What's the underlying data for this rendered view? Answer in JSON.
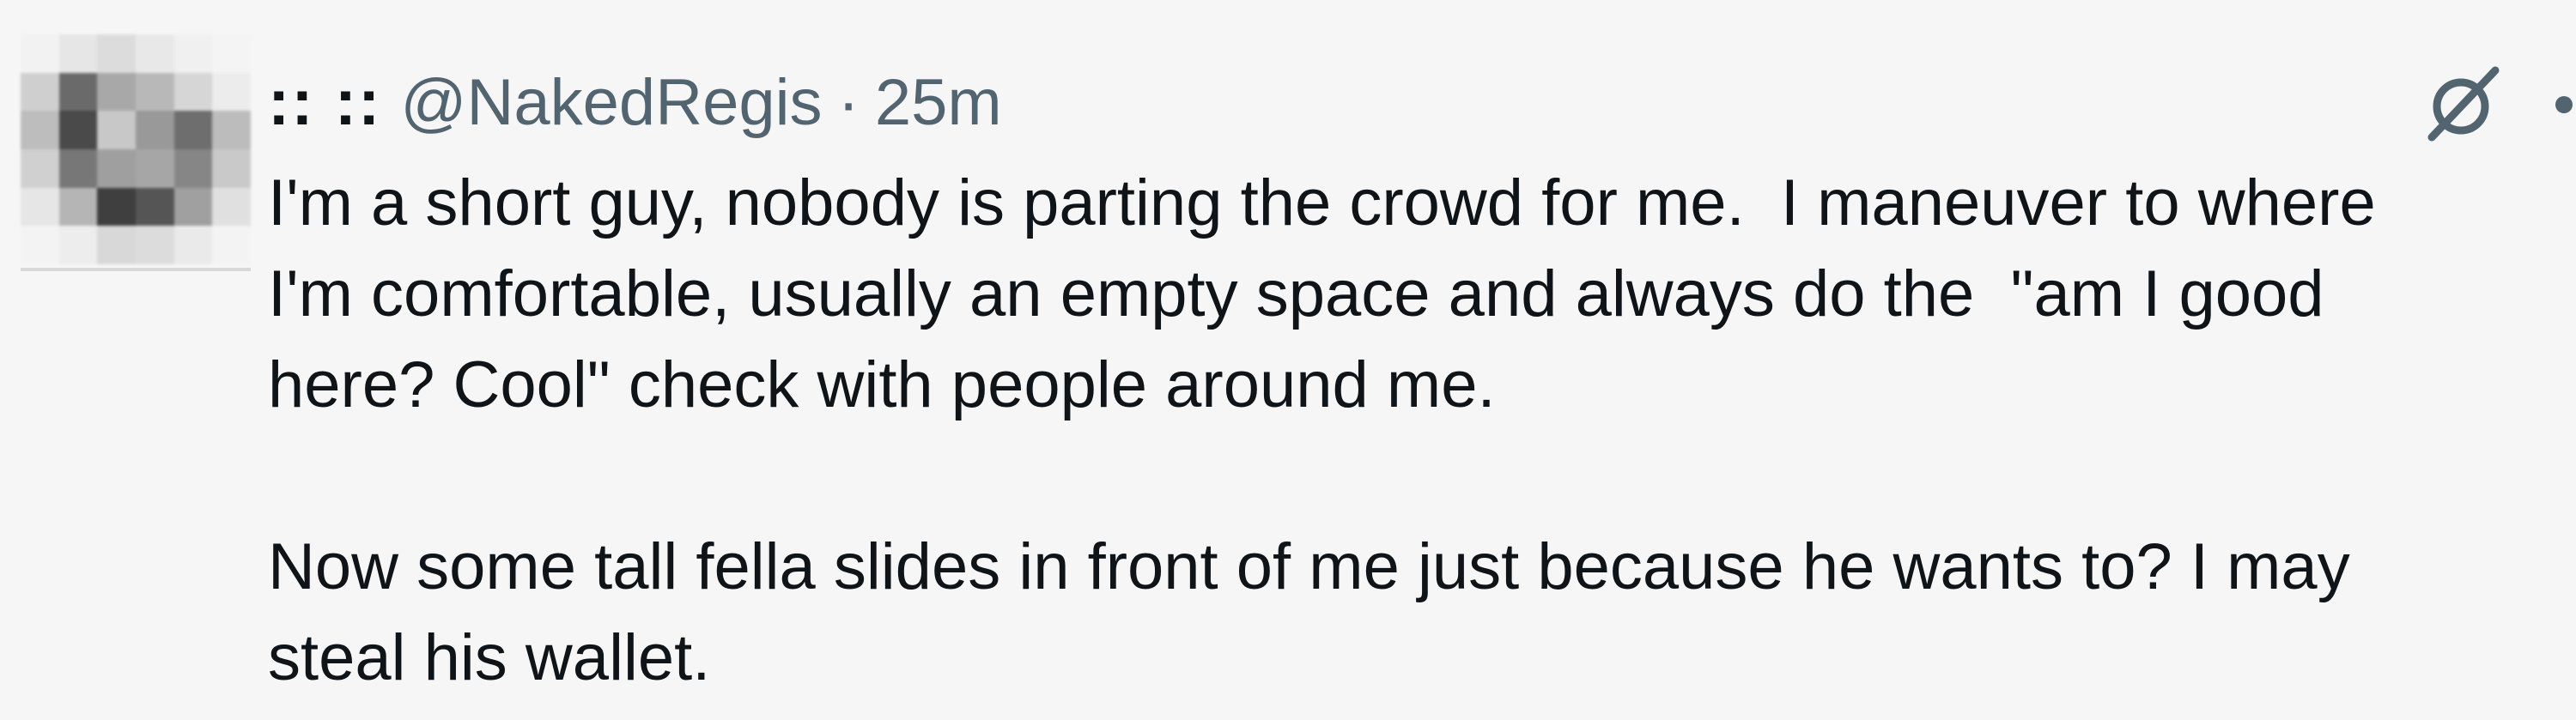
{
  "tweet": {
    "display_name": ":: ::",
    "handle": "@NakedRegis",
    "separator": "·",
    "time": "25m",
    "paragraphs": [
      "I'm a short guy, nobody is parting the crowd for me.  I maneuver to where\nI'm comfortable, usually an empty space and always do the  \"am I good\nhere? Cool\" check with people around me.",
      "Now some tall fella slides in front of me just because he wants to? I may\nsteal his wallet."
    ]
  },
  "avatar": {
    "pixels": [
      [
        "#f2f2f2",
        "#e6e6e6",
        "#dcdcdc",
        "#e8e8e8",
        "#f0f0f0",
        "#f4f4f4"
      ],
      [
        "#cfcfcf",
        "#6a6a6a",
        "#a8a8a8",
        "#b8b8b8",
        "#d6d6d6",
        "#ececec"
      ],
      [
        "#bdbdbd",
        "#4a4a4a",
        "#c8c8c8",
        "#999999",
        "#6e6e6e",
        "#bcbcbc"
      ],
      [
        "#d0d0d0",
        "#777777",
        "#9f9f9f",
        "#a6a6a6",
        "#868686",
        "#c9c9c9"
      ],
      [
        "#e6e6e6",
        "#b5b5b5",
        "#3f3f3f",
        "#555555",
        "#a0a0a0",
        "#e0e0e0"
      ],
      [
        "#f3f3f3",
        "#ededed",
        "#d8d8d8",
        "#dcdcdc",
        "#eaeaea",
        "#f3f3f3"
      ]
    ]
  },
  "icons": {
    "grok": "grok-icon",
    "more": "more-icon"
  },
  "colors": {
    "background": "#f6f6f6",
    "text": "#0f1419",
    "secondary": "#536471"
  }
}
